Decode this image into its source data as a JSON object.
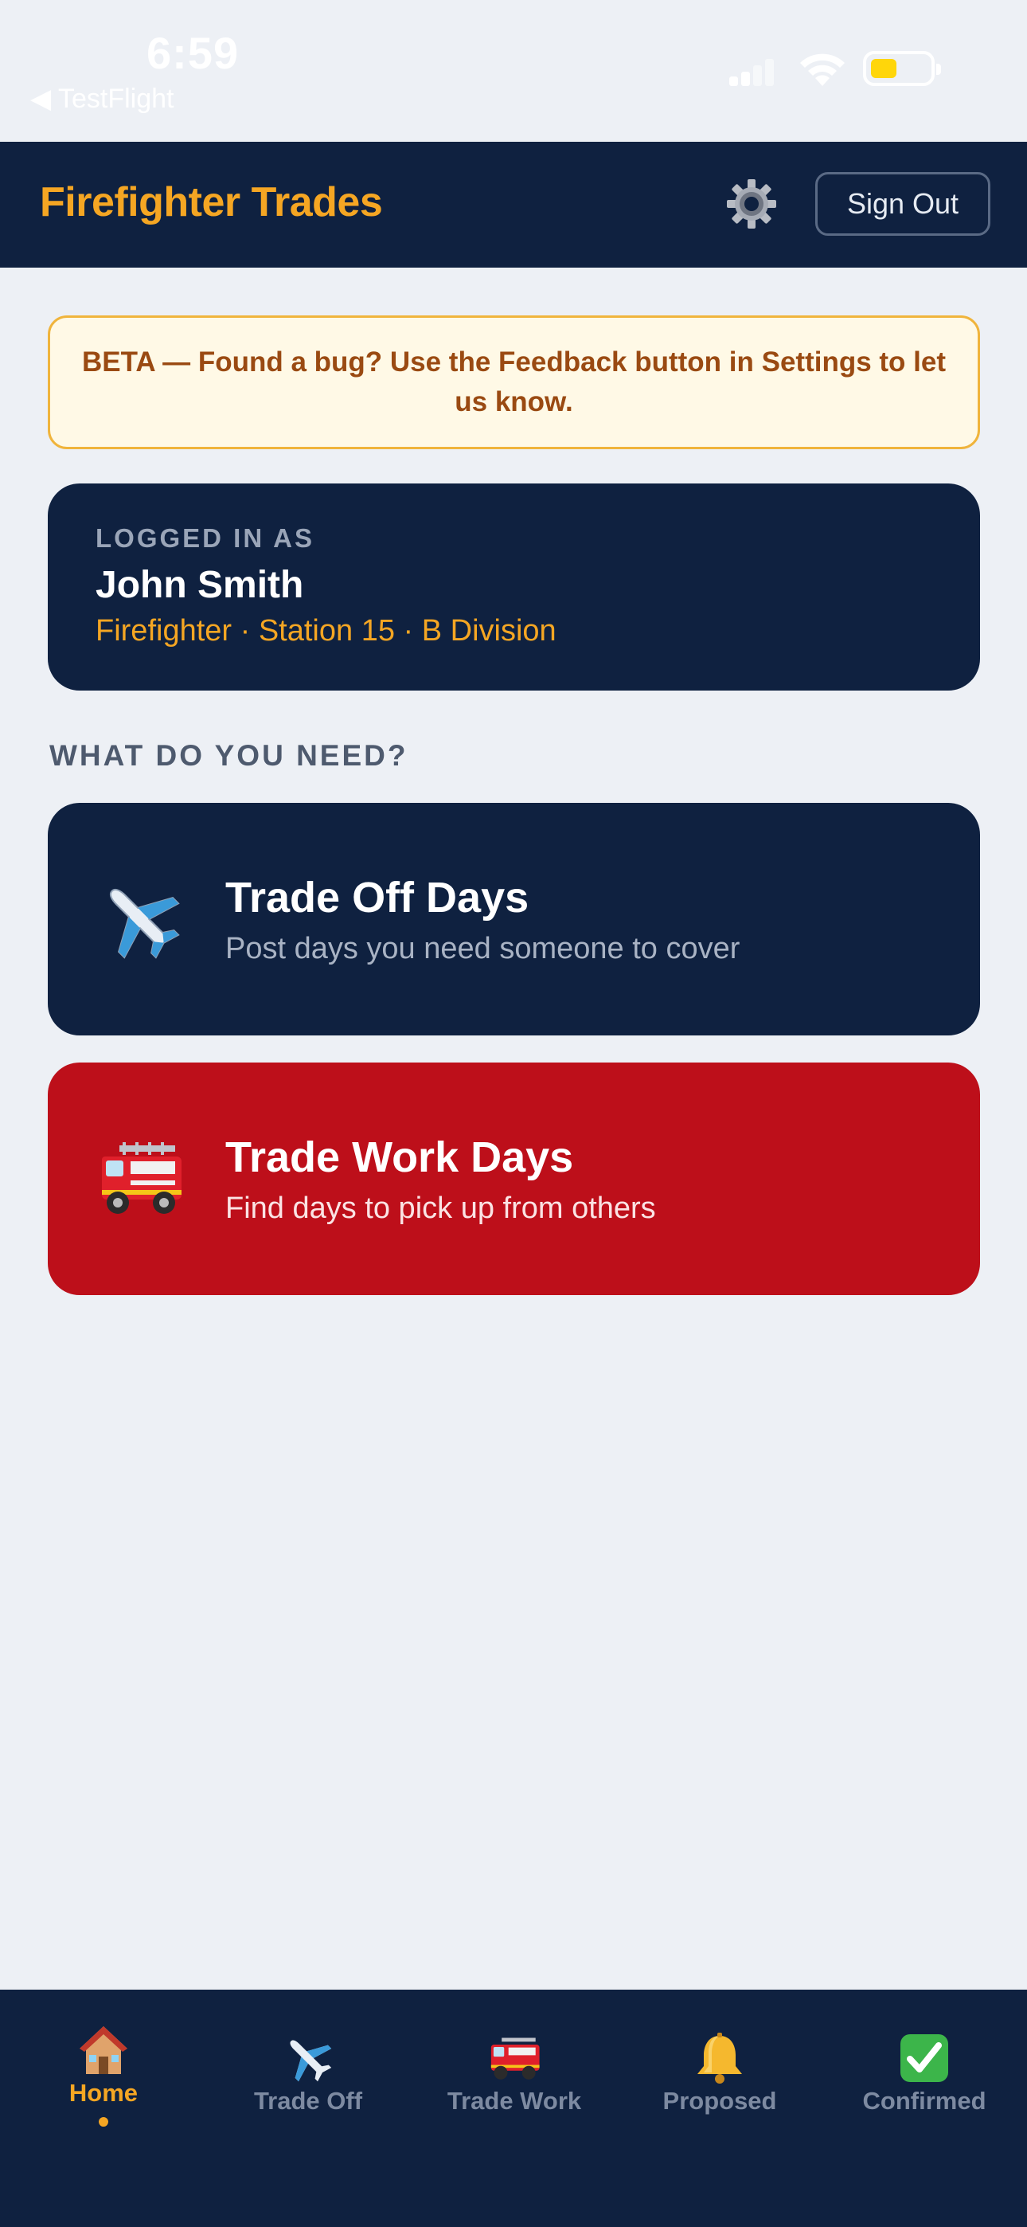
{
  "status_bar": {
    "time": "6:59",
    "back_app": "◀ TestFlight"
  },
  "header": {
    "title": "Firefighter Trades",
    "sign_out_label": "Sign Out",
    "settings_icon": "gear-icon"
  },
  "beta_banner": {
    "text": "BETA — Found a bug? Use the Feedback button in Settings to let us know."
  },
  "user_card": {
    "label": "LOGGED IN AS",
    "name": "John Smith",
    "meta": "Firefighter · Station 15 · B Division"
  },
  "section": {
    "label": "WHAT DO YOU NEED?"
  },
  "actions": [
    {
      "title": "Trade Off Days",
      "subtitle": "Post days you need someone to cover",
      "icon": "airplane-icon",
      "color": "#0f2140"
    },
    {
      "title": "Trade Work Days",
      "subtitle": "Find days to pick up from others",
      "icon": "fire-engine-icon",
      "color": "#bd0f1a"
    }
  ],
  "tabs": [
    {
      "label": "Home",
      "icon": "house-icon",
      "active": true
    },
    {
      "label": "Trade Off",
      "icon": "airplane-icon",
      "active": false
    },
    {
      "label": "Trade Work",
      "icon": "fire-engine-icon",
      "active": false
    },
    {
      "label": "Proposed",
      "icon": "bell-icon",
      "active": false
    },
    {
      "label": "Confirmed",
      "icon": "check-mark-icon",
      "active": false
    }
  ],
  "colors": {
    "navy": "#0f2140",
    "accent": "#f5a623",
    "red": "#bd0f1a",
    "background": "#edf0f5"
  }
}
